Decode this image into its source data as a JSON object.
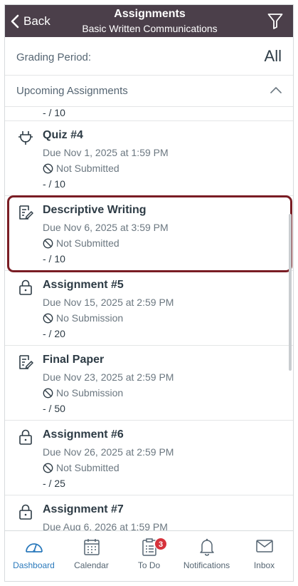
{
  "header": {
    "back_label": "Back",
    "title": "Assignments",
    "subtitle": "Basic Written Communications",
    "bg_color": "#4b3f4a"
  },
  "grading_period": {
    "label": "Grading Period:",
    "value": "All"
  },
  "section": {
    "label": "Upcoming Assignments"
  },
  "previous_item_points": "- / 10",
  "assignments": [
    {
      "icon": "quiz-plug-icon",
      "title": "Quiz #4",
      "due": "Due Nov 1, 2025 at 1:59 PM",
      "status": "Not Submitted",
      "points": "- / 10"
    },
    {
      "icon": "assignment-icon",
      "title": "Descriptive Writing",
      "due": "Due Nov 6, 2025 at 3:59 PM",
      "status": "Not Submitted",
      "points": "- / 10",
      "highlighted": true
    },
    {
      "icon": "lock-icon",
      "title": "Assignment #5",
      "due": "Due Nov 15, 2025 at 2:59 PM",
      "status": "No Submission",
      "points": "- / 20"
    },
    {
      "icon": "assignment-icon",
      "title": "Final Paper",
      "due": "Due Nov 23, 2025 at 2:59 PM",
      "status": "No Submission",
      "points": "- / 50"
    },
    {
      "icon": "lock-icon",
      "title": "Assignment #6",
      "due": "Due Nov 26, 2025 at 2:59 PM",
      "status": "Not Submitted",
      "points": "- / 25"
    },
    {
      "icon": "lock-icon",
      "title": "Assignment #7",
      "due": "Due Aug 6, 2026 at 1:59 PM",
      "status": "",
      "points": ""
    }
  ],
  "tabbar": {
    "tabs": [
      {
        "label": "Dashboard",
        "icon": "dashboard-icon",
        "active": true
      },
      {
        "label": "Calendar",
        "icon": "calendar-icon"
      },
      {
        "label": "To Do",
        "icon": "todo-icon",
        "badge": "3"
      },
      {
        "label": "Notifications",
        "icon": "bell-icon"
      },
      {
        "label": "Inbox",
        "icon": "mail-icon"
      }
    ],
    "active_color": "#2b7abc",
    "badge_color": "#d6323b"
  },
  "highlight_color": "#7a1d24"
}
